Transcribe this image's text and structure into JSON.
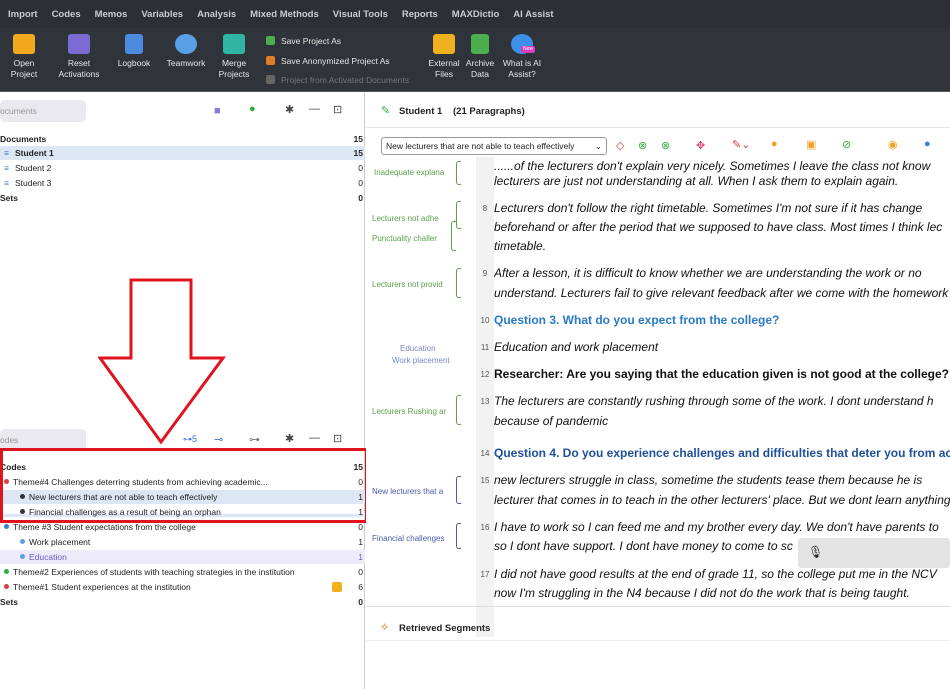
{
  "menu": [
    "Import",
    "Codes",
    "Memos",
    "Variables",
    "Analysis",
    "Mixed Methods",
    "Visual Tools",
    "Reports",
    "MAXDictio",
    "AI Assist"
  ],
  "ribbon": {
    "open_project": "Open Project",
    "reset_activations": "Reset Activations",
    "logbook": "Logbook",
    "teamwork": "Teamwork",
    "merge_projects": "Merge Projects",
    "save_project_as": "Save Project As",
    "save_anonymized": "Save Anonymized Project As",
    "project_from_activated": "Project from Activated Documents",
    "external_files": "External Files",
    "archive_data": "Archive Data",
    "what_is_ai": "What is AI Assist?",
    "new_badge": "New"
  },
  "documents": {
    "search_placeholder": "ocuments",
    "header": "Documents",
    "header_count": "15",
    "items": [
      {
        "label": "Student 1",
        "count": "15"
      },
      {
        "label": "Student 2",
        "count": "0"
      },
      {
        "label": "Student 3",
        "count": "0"
      }
    ],
    "sets": "Sets",
    "sets_count": "0"
  },
  "codes": {
    "search_placeholder": "odes",
    "toolbar_count": "5",
    "header": "Codes",
    "header_count": "15",
    "items": [
      {
        "label": "Theme#4 Challenges deterring students from achieving academic...",
        "count": "0"
      },
      {
        "label": "New lecturers that are not able to teach effectively",
        "count": "1"
      },
      {
        "label": "Financial challenges as a result of being an orphan",
        "count": "1"
      },
      {
        "label": "Theme #3 Student expectations from the college",
        "count": "0"
      },
      {
        "label": "Work placement",
        "count": "1"
      },
      {
        "label": "Education",
        "count": "1"
      },
      {
        "label": "Theme#2 Experiences of students with teaching strategies in the institution",
        "count": "0"
      },
      {
        "label": "Theme#1 Student experiences at the institution",
        "count": "6"
      }
    ],
    "sets": "Sets",
    "sets_count": "0"
  },
  "browser": {
    "doc_title": "Student 1",
    "paragraphs": "(21 Paragraphs)",
    "code_select": "New lecturers that are not able to teach effectively",
    "retrieved": "Retrieved Segments"
  },
  "gutter": [
    "Inadequate explana",
    "Lecturers not adhe",
    "Punctuality challer",
    "Lecturers not provid",
    "Education",
    "Work placement",
    "Lecturers Rushing ar",
    "New lecturers that a",
    "Financial challenges"
  ],
  "paragraphs": [
    {
      "n": "",
      "text": "......of the lecturers don't explain very nicely. Sometimes I leave the class not know"
    },
    {
      "n": "",
      "text": "lecturers are just not understanding at all. When I ask them to explain again."
    },
    {
      "n": "8",
      "text": "Lecturers don't follow the right timetable. Sometimes I'm not sure if it has change"
    },
    {
      "n": "",
      "text": "beforehand or after the period that we supposed to have class. Most times I think lec"
    },
    {
      "n": "",
      "text": "timetable."
    },
    {
      "n": "9",
      "text": "After a lesson, it is difficult to know whether we are understanding the work or no"
    },
    {
      "n": "",
      "text": "understand. Lecturers fail to give relevant feedback after we come with the homework"
    },
    {
      "n": "10",
      "text": "Question 3. What do you expect from the college?"
    },
    {
      "n": "11",
      "text": "Education and work placement"
    },
    {
      "n": "12",
      "text": "Researcher: Are you saying that the education given is not good at the college?"
    },
    {
      "n": "13",
      "text": "The lecturers are constantly rushing through some of the work. I dont understand h"
    },
    {
      "n": "",
      "text": "because of pandemic"
    },
    {
      "n": "14",
      "text": "Question 4. Do you experience challenges and difficulties that deter you from ac"
    },
    {
      "n": "15",
      "text": "new lecturers struggle in class, sometime the students tease them because he is"
    },
    {
      "n": "",
      "text": "lecturer that comes in to teach in the other lecturers' place. But we dont learn anything"
    },
    {
      "n": "16",
      "text": "I have to work so I can feed me and my brother every day. We don't have parents to"
    },
    {
      "n": "",
      "text": "so I dont have support. I dont have money to come to sc"
    },
    {
      "n": "17",
      "text": "I did not have good results at the end of grade 11, so the college put me in the NCV"
    },
    {
      "n": "",
      "text": "now I'm struggling in the N4 because I did not do the work that is being taught."
    }
  ]
}
